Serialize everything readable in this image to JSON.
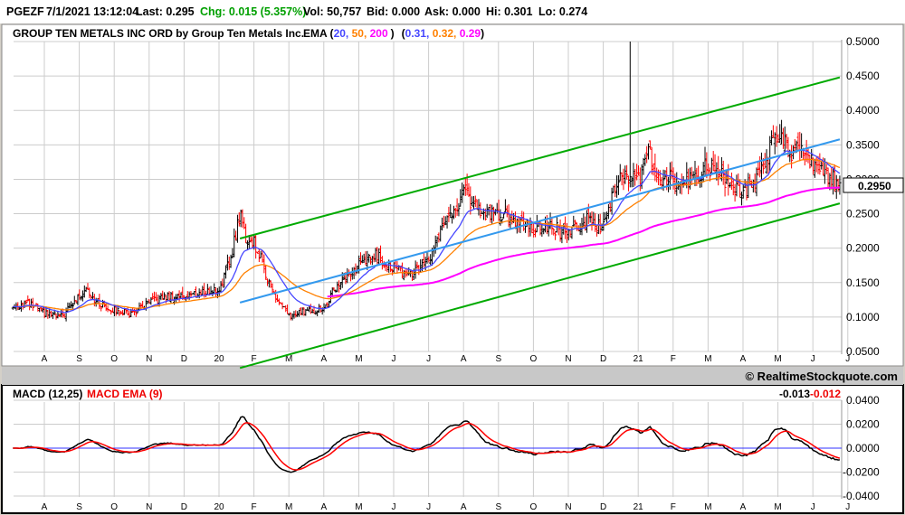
{
  "header": {
    "symbol": "PGEZF",
    "datetime": "7/1/2021 13:12:04",
    "last": "Last: 0.295",
    "chg": "Chg: 0.015 (5.357%)",
    "vol": "Vol: 50,757",
    "bid": "Bid: 0.000",
    "ask": "Ask: 0.000",
    "hi": "Hi: 0.301",
    "lo": "Lo: 0.274"
  },
  "copyright": "© RealtimeStockquote.com",
  "chart_data": [
    {
      "type": "ohlc",
      "title": "GROUP TEN METALS INC ORD by Group Ten Metals Inc.",
      "ema_label": "EMA (",
      "ema_periods": [
        "20,",
        "50,",
        "200"
      ],
      "ema_close": ")",
      "ema_values": [
        "0.31,",
        "0.32,",
        "0.29"
      ],
      "ema_paren_open": "(",
      "ema_paren_close": ")",
      "colors": {
        "up": "#000000",
        "down": "#ff0000",
        "ema20": "#4646ff",
        "ema50": "#ff8000",
        "ema200": "#ff00ff",
        "channel": "#00aa00",
        "trend": "#3399ee"
      },
      "x_ticks": [
        "A",
        "S",
        "O",
        "N",
        "D",
        "20",
        "F",
        "M",
        "A",
        "M",
        "J",
        "J",
        "A",
        "S",
        "O",
        "N",
        "D",
        "21",
        "F",
        "M",
        "A",
        "M",
        "J",
        "J"
      ],
      "y_ticks": [
        "0.5000",
        "0.4500",
        "0.4000",
        "0.3500",
        "0.3000",
        "0.2500",
        "0.2000",
        "0.1500",
        "0.1000",
        "0.0500"
      ],
      "y_tick_values": [
        0.5,
        0.45,
        0.4,
        0.35,
        0.3,
        0.25,
        0.2,
        0.15,
        0.1,
        0.05
      ],
      "ylim": [
        0.05,
        0.5
      ],
      "current_price": "0.2950",
      "current_value": 0.295,
      "close_anchors_month_index": [
        [
          -0.9,
          0.115
        ],
        [
          -0.5,
          0.12
        ],
        [
          0,
          0.105
        ],
        [
          0.5,
          0.1
        ],
        [
          1,
          0.13
        ],
        [
          1.2,
          0.145
        ],
        [
          1.5,
          0.12
        ],
        [
          2,
          0.11
        ],
        [
          2.5,
          0.105
        ],
        [
          3,
          0.12
        ],
        [
          3.5,
          0.13
        ],
        [
          4,
          0.13
        ],
        [
          4.5,
          0.135
        ],
        [
          5,
          0.14
        ],
        [
          5.3,
          0.18
        ],
        [
          5.6,
          0.25
        ],
        [
          5.8,
          0.21
        ],
        [
          6,
          0.21
        ],
        [
          6.3,
          0.17
        ],
        [
          6.6,
          0.13
        ],
        [
          7,
          0.1
        ],
        [
          7.5,
          0.11
        ],
        [
          8,
          0.11
        ],
        [
          8.3,
          0.14
        ],
        [
          8.7,
          0.16
        ],
        [
          9,
          0.175
        ],
        [
          9.5,
          0.19
        ],
        [
          10,
          0.17
        ],
        [
          10.5,
          0.16
        ],
        [
          11,
          0.18
        ],
        [
          11.5,
          0.24
        ],
        [
          12,
          0.28
        ],
        [
          12.5,
          0.25
        ],
        [
          13,
          0.25
        ],
        [
          13.5,
          0.24
        ],
        [
          14,
          0.23
        ],
        [
          14.5,
          0.23
        ],
        [
          15,
          0.22
        ],
        [
          15.5,
          0.24
        ],
        [
          16,
          0.23
        ],
        [
          16.5,
          0.31
        ],
        [
          17,
          0.3
        ],
        [
          17.3,
          0.34
        ],
        [
          17.6,
          0.3
        ],
        [
          18,
          0.3
        ],
        [
          18.5,
          0.3
        ],
        [
          19,
          0.32
        ],
        [
          19.5,
          0.3
        ],
        [
          20,
          0.28
        ],
        [
          20.5,
          0.31
        ],
        [
          21,
          0.37
        ],
        [
          21.4,
          0.34
        ],
        [
          21.7,
          0.35
        ],
        [
          22,
          0.32
        ],
        [
          22.5,
          0.3
        ],
        [
          22.77,
          0.295
        ]
      ],
      "channel": {
        "upper": [
          [
            5.6,
            0.214
          ],
          [
            22.77,
            0.448
          ]
        ],
        "middle": [
          [
            5.6,
            0.121
          ],
          [
            22.77,
            0.358
          ]
        ],
        "lower": [
          [
            5.6,
            0.026
          ],
          [
            22.77,
            0.265
          ]
        ]
      }
    },
    {
      "type": "line",
      "title": "MACD (12,25)",
      "signal_label": "MACD EMA (9)",
      "macd_value": "-0.013",
      "signal_value": "-0.012",
      "y_ticks": [
        "0.0400",
        "0.0200",
        "0.0000",
        "-0.0200",
        "-0.0400"
      ],
      "y_tick_values": [
        0.04,
        0.02,
        0,
        -0.02,
        -0.04
      ],
      "ylim": [
        -0.04,
        0.04
      ],
      "colors": {
        "macd": "#000000",
        "signal": "#ff0000",
        "zero": "#3333ff"
      }
    }
  ]
}
